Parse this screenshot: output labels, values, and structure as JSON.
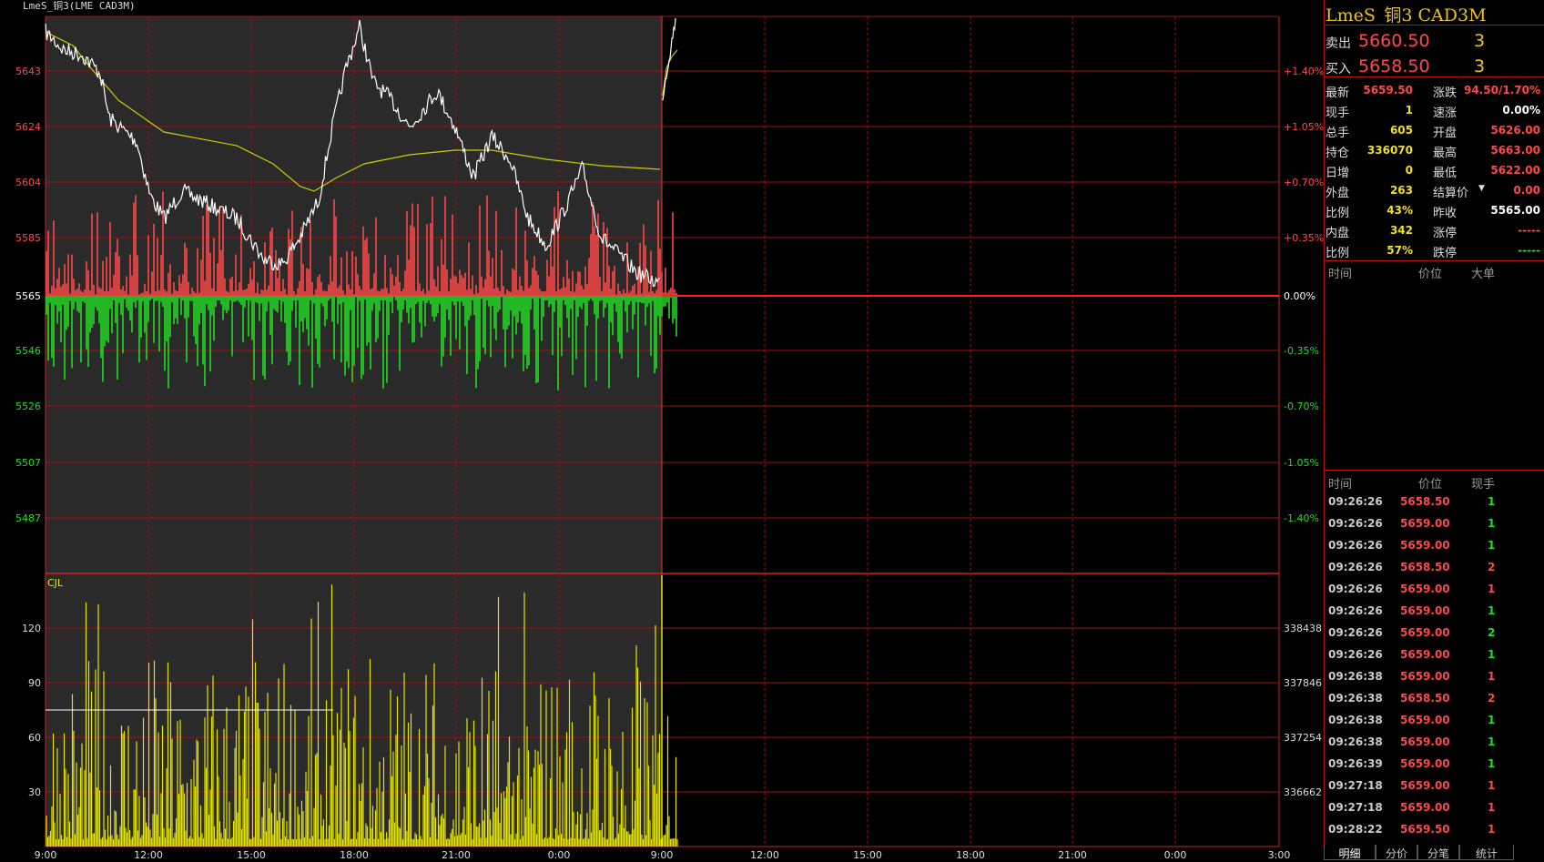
{
  "window": {
    "chart_caption": "LmeS_铜3(LME CAD3M)"
  },
  "colors": {
    "up": "#ff4848",
    "down": "#22dd22",
    "price_line": "#ffffff",
    "avg_line": "#cccc00",
    "volume": "#e5e500",
    "grid": "#a01010",
    "plot_bg": "#2a2a2a"
  },
  "main_chart": {
    "left_axis": [
      "5643",
      "5624",
      "5604",
      "5585",
      "5565",
      "5546",
      "5526",
      "5507",
      "5487"
    ],
    "right_axis": [
      "+1.40%",
      "+1.05%",
      "+0.70%",
      "+0.35%",
      "0.00%",
      "-0.35%",
      "-0.70%",
      "-1.05%",
      "-1.40%"
    ],
    "prev_close": 5565,
    "tick_step": 19.4
  },
  "volume_chart": {
    "label": "CJL",
    "left_axis": [
      "120",
      "90",
      "60",
      "30"
    ],
    "right_axis": [
      "338438",
      "337846",
      "337254",
      "336662"
    ]
  },
  "time_axis": [
    "9:00",
    "12:00",
    "15:00",
    "18:00",
    "21:00",
    "0:00",
    "9:00",
    "12:00",
    "15:00",
    "18:00",
    "21:00",
    "0:00",
    "3:00"
  ],
  "quote": {
    "title": "LmeS_铜3 CAD3M",
    "sell_label": "卖出",
    "sell_price": "5660.50",
    "sell_vol": "3",
    "buy_label": "买入",
    "buy_price": "5658.50",
    "buy_vol": "3"
  },
  "stats": [
    {
      "l1": "最新",
      "v1": "5659.50",
      "c1": "red",
      "l2": "涨跌",
      "v2": "94.50/1.70%",
      "c2": "red"
    },
    {
      "l1": "现手",
      "v1": "1",
      "c1": "yellow",
      "l2": "速涨",
      "v2": "0.00%",
      "c2": "white"
    },
    {
      "l1": "总手",
      "v1": "605",
      "c1": "yellow",
      "l2": "开盘",
      "v2": "5626.00",
      "c2": "red"
    },
    {
      "l1": "持仓",
      "v1": "336070",
      "c1": "yellow",
      "l2": "最高",
      "v2": "5663.00",
      "c2": "red"
    },
    {
      "l1": "日增",
      "v1": "0",
      "c1": "yellow",
      "l2": "最低",
      "v2": "5622.00",
      "c2": "red"
    },
    {
      "l1": "外盘",
      "v1": "263",
      "c1": "yellow",
      "l2": "结算价",
      "v2": "0.00",
      "c2": "red"
    },
    {
      "l1": "比例",
      "v1": "43%",
      "c1": "yellow",
      "l2": "昨收",
      "v2": "5565.00",
      "c2": "white"
    },
    {
      "l1": "内盘",
      "v1": "342",
      "c1": "yellow",
      "l2": "涨停",
      "v2": "-----",
      "c2": "red"
    },
    {
      "l1": "比例",
      "v1": "57%",
      "c1": "yellow",
      "l2": "跌停",
      "v2": "-----",
      "c2": "green"
    }
  ],
  "big_orders": {
    "h_time": "时间",
    "h_price": "价位",
    "h_big": "大单"
  },
  "ticks": {
    "h_time": "时间",
    "h_price": "价位",
    "h_vol": "现手",
    "rows": [
      {
        "time": "09:26:26",
        "price": "5658.50",
        "vol": "1",
        "dir": "down"
      },
      {
        "time": "09:26:26",
        "price": "5659.00",
        "vol": "1",
        "dir": "down"
      },
      {
        "time": "09:26:26",
        "price": "5659.00",
        "vol": "1",
        "dir": "down"
      },
      {
        "time": "09:26:26",
        "price": "5658.50",
        "vol": "2",
        "dir": "up"
      },
      {
        "time": "09:26:26",
        "price": "5659.00",
        "vol": "1",
        "dir": "up"
      },
      {
        "time": "09:26:26",
        "price": "5659.00",
        "vol": "1",
        "dir": "down"
      },
      {
        "time": "09:26:26",
        "price": "5659.00",
        "vol": "2",
        "dir": "down"
      },
      {
        "time": "09:26:26",
        "price": "5659.00",
        "vol": "1",
        "dir": "down"
      },
      {
        "time": "09:26:38",
        "price": "5659.00",
        "vol": "1",
        "dir": "up"
      },
      {
        "time": "09:26:38",
        "price": "5658.50",
        "vol": "2",
        "dir": "up"
      },
      {
        "time": "09:26:38",
        "price": "5659.00",
        "vol": "1",
        "dir": "down"
      },
      {
        "time": "09:26:38",
        "price": "5659.00",
        "vol": "1",
        "dir": "down"
      },
      {
        "time": "09:26:39",
        "price": "5659.00",
        "vol": "1",
        "dir": "down"
      },
      {
        "time": "09:27:18",
        "price": "5659.00",
        "vol": "1",
        "dir": "up"
      },
      {
        "time": "09:27:18",
        "price": "5659.00",
        "vol": "1",
        "dir": "up"
      },
      {
        "time": "09:28:22",
        "price": "5659.50",
        "vol": "1",
        "dir": "up"
      }
    ]
  },
  "tabs": [
    "明细",
    "分价",
    "分笔",
    "统计"
  ]
}
